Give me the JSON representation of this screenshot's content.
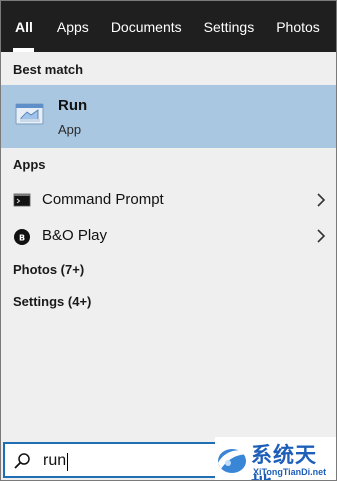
{
  "tabs": [
    "All",
    "Apps",
    "Documents",
    "Settings",
    "Photos"
  ],
  "best_match": {
    "heading": "Best match",
    "title": "Run",
    "subtitle": "App",
    "icon": "run-dialog-icon"
  },
  "apps_section": {
    "heading": "Apps",
    "items": [
      {
        "label": "Command Prompt",
        "icon": "command-prompt-icon"
      },
      {
        "label": "B&O Play",
        "icon": "bo-play-icon"
      }
    ]
  },
  "photos_section": {
    "label": "Photos (7+)"
  },
  "settings_section": {
    "label": "Settings (4+)"
  },
  "search": {
    "value": "run",
    "icon": "search-icon"
  },
  "watermark": {
    "main": "系统天地",
    "sub": "XiTongTianDi.net"
  },
  "colors": {
    "tab_bar": "#1f1f1f",
    "panel_bg": "#efefef",
    "selected_bg": "#a9c7e0",
    "search_border": "#1f6fb5",
    "watermark_blue": "#1d5fb8"
  }
}
